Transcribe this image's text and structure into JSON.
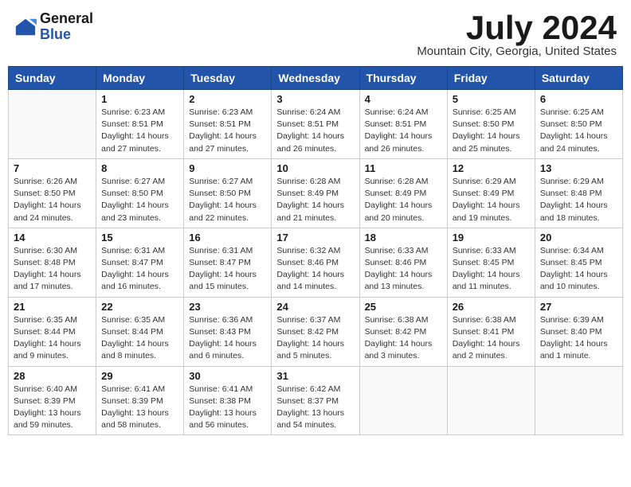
{
  "logo": {
    "general": "General",
    "blue": "Blue"
  },
  "title": "July 2024",
  "location": "Mountain City, Georgia, United States",
  "days_header": [
    "Sunday",
    "Monday",
    "Tuesday",
    "Wednesday",
    "Thursday",
    "Friday",
    "Saturday"
  ],
  "weeks": [
    [
      {
        "day": "",
        "info": ""
      },
      {
        "day": "1",
        "info": "Sunrise: 6:23 AM\nSunset: 8:51 PM\nDaylight: 14 hours\nand 27 minutes."
      },
      {
        "day": "2",
        "info": "Sunrise: 6:23 AM\nSunset: 8:51 PM\nDaylight: 14 hours\nand 27 minutes."
      },
      {
        "day": "3",
        "info": "Sunrise: 6:24 AM\nSunset: 8:51 PM\nDaylight: 14 hours\nand 26 minutes."
      },
      {
        "day": "4",
        "info": "Sunrise: 6:24 AM\nSunset: 8:51 PM\nDaylight: 14 hours\nand 26 minutes."
      },
      {
        "day": "5",
        "info": "Sunrise: 6:25 AM\nSunset: 8:50 PM\nDaylight: 14 hours\nand 25 minutes."
      },
      {
        "day": "6",
        "info": "Sunrise: 6:25 AM\nSunset: 8:50 PM\nDaylight: 14 hours\nand 24 minutes."
      }
    ],
    [
      {
        "day": "7",
        "info": "Sunrise: 6:26 AM\nSunset: 8:50 PM\nDaylight: 14 hours\nand 24 minutes."
      },
      {
        "day": "8",
        "info": "Sunrise: 6:27 AM\nSunset: 8:50 PM\nDaylight: 14 hours\nand 23 minutes."
      },
      {
        "day": "9",
        "info": "Sunrise: 6:27 AM\nSunset: 8:50 PM\nDaylight: 14 hours\nand 22 minutes."
      },
      {
        "day": "10",
        "info": "Sunrise: 6:28 AM\nSunset: 8:49 PM\nDaylight: 14 hours\nand 21 minutes."
      },
      {
        "day": "11",
        "info": "Sunrise: 6:28 AM\nSunset: 8:49 PM\nDaylight: 14 hours\nand 20 minutes."
      },
      {
        "day": "12",
        "info": "Sunrise: 6:29 AM\nSunset: 8:49 PM\nDaylight: 14 hours\nand 19 minutes."
      },
      {
        "day": "13",
        "info": "Sunrise: 6:29 AM\nSunset: 8:48 PM\nDaylight: 14 hours\nand 18 minutes."
      }
    ],
    [
      {
        "day": "14",
        "info": "Sunrise: 6:30 AM\nSunset: 8:48 PM\nDaylight: 14 hours\nand 17 minutes."
      },
      {
        "day": "15",
        "info": "Sunrise: 6:31 AM\nSunset: 8:47 PM\nDaylight: 14 hours\nand 16 minutes."
      },
      {
        "day": "16",
        "info": "Sunrise: 6:31 AM\nSunset: 8:47 PM\nDaylight: 14 hours\nand 15 minutes."
      },
      {
        "day": "17",
        "info": "Sunrise: 6:32 AM\nSunset: 8:46 PM\nDaylight: 14 hours\nand 14 minutes."
      },
      {
        "day": "18",
        "info": "Sunrise: 6:33 AM\nSunset: 8:46 PM\nDaylight: 14 hours\nand 13 minutes."
      },
      {
        "day": "19",
        "info": "Sunrise: 6:33 AM\nSunset: 8:45 PM\nDaylight: 14 hours\nand 11 minutes."
      },
      {
        "day": "20",
        "info": "Sunrise: 6:34 AM\nSunset: 8:45 PM\nDaylight: 14 hours\nand 10 minutes."
      }
    ],
    [
      {
        "day": "21",
        "info": "Sunrise: 6:35 AM\nSunset: 8:44 PM\nDaylight: 14 hours\nand 9 minutes."
      },
      {
        "day": "22",
        "info": "Sunrise: 6:35 AM\nSunset: 8:44 PM\nDaylight: 14 hours\nand 8 minutes."
      },
      {
        "day": "23",
        "info": "Sunrise: 6:36 AM\nSunset: 8:43 PM\nDaylight: 14 hours\nand 6 minutes."
      },
      {
        "day": "24",
        "info": "Sunrise: 6:37 AM\nSunset: 8:42 PM\nDaylight: 14 hours\nand 5 minutes."
      },
      {
        "day": "25",
        "info": "Sunrise: 6:38 AM\nSunset: 8:42 PM\nDaylight: 14 hours\nand 3 minutes."
      },
      {
        "day": "26",
        "info": "Sunrise: 6:38 AM\nSunset: 8:41 PM\nDaylight: 14 hours\nand 2 minutes."
      },
      {
        "day": "27",
        "info": "Sunrise: 6:39 AM\nSunset: 8:40 PM\nDaylight: 14 hours\nand 1 minute."
      }
    ],
    [
      {
        "day": "28",
        "info": "Sunrise: 6:40 AM\nSunset: 8:39 PM\nDaylight: 13 hours\nand 59 minutes."
      },
      {
        "day": "29",
        "info": "Sunrise: 6:41 AM\nSunset: 8:39 PM\nDaylight: 13 hours\nand 58 minutes."
      },
      {
        "day": "30",
        "info": "Sunrise: 6:41 AM\nSunset: 8:38 PM\nDaylight: 13 hours\nand 56 minutes."
      },
      {
        "day": "31",
        "info": "Sunrise: 6:42 AM\nSunset: 8:37 PM\nDaylight: 13 hours\nand 54 minutes."
      },
      {
        "day": "",
        "info": ""
      },
      {
        "day": "",
        "info": ""
      },
      {
        "day": "",
        "info": ""
      }
    ]
  ]
}
